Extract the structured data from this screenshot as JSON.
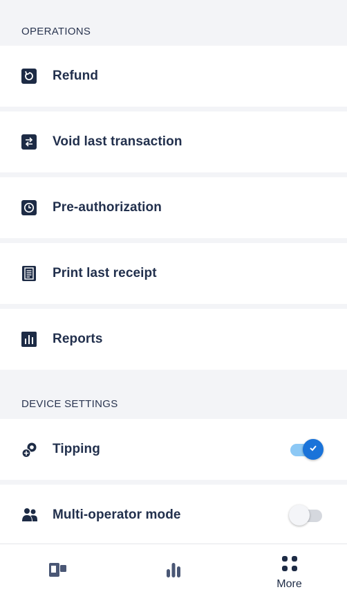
{
  "operations": {
    "header": "OPERATIONS",
    "items": [
      {
        "label": "Refund",
        "icon": "refund-icon"
      },
      {
        "label": "Void last transaction",
        "icon": "void-icon"
      },
      {
        "label": "Pre-authorization",
        "icon": "clock-icon"
      },
      {
        "label": "Print last receipt",
        "icon": "receipt-icon"
      },
      {
        "label": "Reports",
        "icon": "reports-icon"
      }
    ]
  },
  "device_settings": {
    "header": "DEVICE SETTINGS",
    "items": [
      {
        "label": "Tipping",
        "icon": "tipping-icon",
        "enabled": true
      },
      {
        "label": "Multi-operator mode",
        "icon": "operators-icon",
        "enabled": false
      }
    ]
  },
  "bottom_nav": {
    "items": [
      {
        "icon": "terminal-icon",
        "label": ""
      },
      {
        "icon": "bar-chart-icon",
        "label": ""
      },
      {
        "icon": "grid-icon",
        "label": "More"
      }
    ]
  },
  "colors": {
    "accent": "#1a73d9",
    "icon": "#1d2b45",
    "background": "#f3f4f7"
  }
}
